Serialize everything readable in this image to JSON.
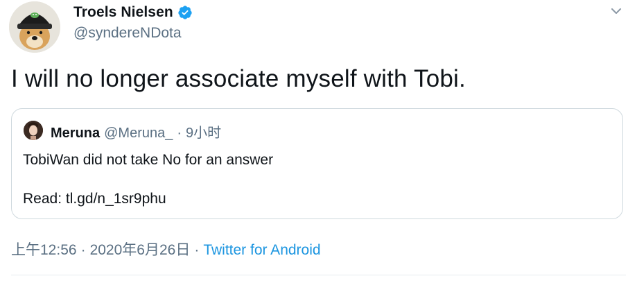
{
  "author": {
    "display_name": "Troels Nielsen",
    "handle": "@syndereNDota",
    "verified": true,
    "avatar_icon": "dog-with-beanie-avatar"
  },
  "tweet": {
    "text": "I will no longer associate myself with Tobi."
  },
  "quoted": {
    "display_name": "Meruna",
    "handle": "@Meruna_",
    "separator": "·",
    "time": "9小时",
    "line1": "TobiWan did not take No for an answer",
    "line2": "Read: tl.gd/n_1sr9phu"
  },
  "meta": {
    "time": "上午12:56",
    "sep1": "·",
    "date": "2020年6月26日",
    "sep2": "·",
    "source": "Twitter for Android"
  },
  "colors": {
    "text": "#0f1419",
    "secondary": "#5b7083",
    "link": "#1b95e0",
    "verified": "#1da1f2",
    "border": "#cfd9de"
  }
}
